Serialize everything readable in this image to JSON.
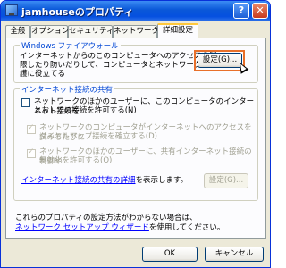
{
  "window": {
    "title": "jamhouseのプロパティ",
    "help_label": "?",
    "close_label": "✕"
  },
  "tabs": [
    {
      "label": "全般"
    },
    {
      "label": "オプション"
    },
    {
      "label": "セキュリティ"
    },
    {
      "label": "ネットワーク"
    },
    {
      "label": "詳細設定"
    }
  ],
  "firewall": {
    "legend": "Windows ファイアウォール",
    "desc_1": "インターネットからのこのコンピュータへのアクセスを制",
    "desc_2": "限したり防いだりして、コンピュータとネットワークの保",
    "desc_3": "護に役立てる",
    "settings_button": "設定(G)..."
  },
  "ics": {
    "legend": "インターネット接続の共有",
    "allow_1": "ネットワークのほかのユーザーに、このコンピュータのインターネット接続を",
    "allow_2": "とおしての接続を許可する(N)",
    "dial_1": "ネットワークのコンピュータがインターネットへのアクセスを試みるたびに",
    "dial_2": "ダイヤルアップ接続を確立する(D)",
    "control_1": "ネットワークのほかのユーザーに、共有インターネット接続の制御や",
    "control_2": "無効化を許可する(O)",
    "learn_link": "インターネット接続の共有の詳細",
    "learn_suffix": "を表示します。",
    "settings_button": "設定(G)..."
  },
  "footer": {
    "line1": "これらのプロパティの設定方法がわからない場合は、",
    "wizard_link": "ネットワーク セットアップ ウィザード",
    "line2_suffix": "を使用してください。"
  },
  "buttons": {
    "ok": "OK",
    "cancel": "キャンセル"
  }
}
